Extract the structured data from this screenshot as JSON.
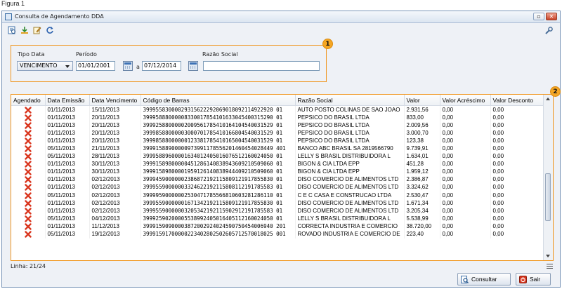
{
  "figure_label": "Figura 1",
  "window": {
    "title": "Consulta de Agendamento DDA",
    "min_glyph": "▫",
    "close_glyph": "✕"
  },
  "badges": {
    "filter": "1",
    "grid": "2"
  },
  "filters": {
    "tipo_data_label": "Tipo Data",
    "tipo_data_value": "VENCIMENTO",
    "periodo_label": "Período",
    "date_from": "01/01/2001",
    "separator": "a",
    "date_to": "07/12/2014",
    "razao_social_label": "Razão Social",
    "razao_social_value": ""
  },
  "table": {
    "columns": [
      "Agendado",
      "Data Emissão",
      "Data Vencimento",
      "Código de Barras",
      "Razão Social",
      "Valor",
      "Valor Acréscimo",
      "Valor Desconto"
    ],
    "rows": [
      [
        "01/11/2013",
        "15/11/2013",
        "39995583000029315622292069018092114922920 01",
        "AUTO POSTO COLINAS DE SAO JOAO",
        "2.931,56",
        "0,00",
        "0,00"
      ],
      [
        "01/11/2013",
        "20/11/2013",
        "39995888000008330017854101633045400315290 01",
        "PEPSICO DO BRASIL LTDA",
        "833,00",
        "0,00",
        "0,00"
      ],
      [
        "01/11/2013",
        "20/11/2013",
        "39992588000002009561785410164104540031529 01",
        "PEPSICO DO BRASIL LTDA",
        "2.009,56",
        "0,00",
        "0,00"
      ],
      [
        "01/11/2013",
        "20/11/2013",
        "39998588000003000701785410166804540031529 01",
        "PEPSICO DO BRASIL LTDA",
        "3.000,70",
        "0,00",
        "0,00"
      ],
      [
        "01/11/2013",
        "20/11/2013",
        "39998588000000123381785410165004540031529 01",
        "PEPSICO DO BRASIL LTDA",
        "123,38",
        "0,00",
        "0,00"
      ],
      [
        "05/11/2013",
        "21/11/2013",
        "39991588900000973991178556201460454028449 401",
        "BANCO ABC BRASIL SA 2819566790",
        "9.739,91",
        "0,00",
        "0,00"
      ],
      [
        "05/11/2013",
        "28/11/2013",
        "39995889600001634012405016076512160024050 01",
        "LELLY S BRASIL DISTRIBUIDORA L",
        "1.634,01",
        "0,00",
        "0,00"
      ],
      [
        "01/11/2013",
        "30/11/2013",
        "39991589800000451286140838943609210509060 01",
        "BIGON & CIA LTDA EPP",
        "451,28",
        "0,00",
        "0,00"
      ],
      [
        "01/11/2013",
        "30/11/2013",
        "39991589800001959126140838944409210509060 01",
        "BIGON & CIA LTDA EPP",
        "1.959,12",
        "0,00",
        "0,00"
      ],
      [
        "01/11/2013",
        "02/12/2013",
        "39994590000002386872192115809121917855830 01",
        "DISO COMERCIO DE ALIMENTOS LTD",
        "2.386,87",
        "0,00",
        "0,00"
      ],
      [
        "01/11/2013",
        "02/12/2013",
        "39995590000003324622192115808112191785583 01",
        "DISO COMERCIO DE ALIMENTOS LTD",
        "3.324,62",
        "0,00",
        "0,00"
      ],
      [
        "05/11/2013",
        "02/12/2013",
        "39999590000002530471785566810603281286110 01",
        "C E C CASA E CONSTRUCAO LTDA",
        "2.530,47",
        "0,00",
        "0,00"
      ],
      [
        "01/11/2013",
        "02/12/2013",
        "39995590000001671342192115809121917855830 01",
        "DISO COMERCIO DE ALIMENTOS LTD",
        "1.671,34",
        "0,00",
        "0,00"
      ],
      [
        "01/11/2013",
        "02/12/2013",
        "39995590000003205342192115902912191785583 01",
        "DISO COMERCIO DE ALIMENTOS LTD",
        "3.205,34",
        "0,00",
        "0,00"
      ],
      [
        "05/11/2013",
        "04/12/2013",
        "39992590200005538992405016405112160024050 01",
        "LELLY S BRASIL DISTRIBUIDORA L",
        "5.538,99",
        "0,00",
        "0,00"
      ],
      [
        "01/11/2013",
        "11/12/2013",
        "39991590900003872002924024590750454006940 201",
        "CORRECTA INDUSTRIA E COMERCIO",
        "38.720,00",
        "0,00",
        "0,00"
      ],
      [
        "05/11/2013",
        "19/12/2013",
        "39991591700000223402802502605712570018025 001",
        "ROVADO INDUSTRIA E COMERCIO DE",
        "223,40",
        "0,00",
        "0,00"
      ]
    ]
  },
  "status": {
    "text": "Linha: 21/24"
  },
  "buttons": {
    "consultar": "Consultar",
    "sair": "Sair"
  },
  "colors": {
    "highlight": "#f0961e",
    "delete_icon": "#d9361f"
  },
  "icons": [
    "report-icon",
    "download-icon",
    "edit-icon",
    "refresh-icon",
    "wrench-icon",
    "calendar-icon",
    "delete-icon",
    "search-icon",
    "exit-icon"
  ]
}
